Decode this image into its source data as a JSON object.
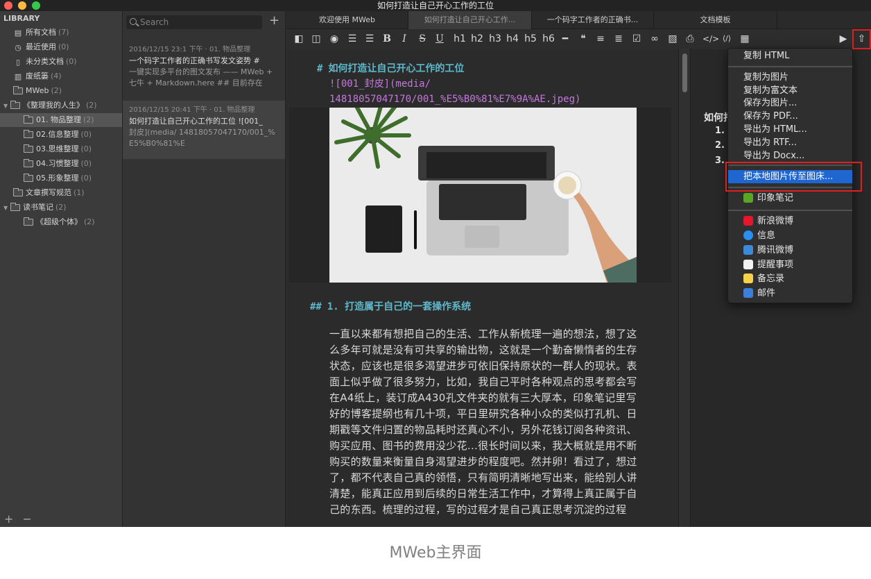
{
  "window": {
    "title": "如何打造让自己开心工作的工位"
  },
  "library": {
    "header": "LIBRARY",
    "items": [
      {
        "label": "所有文档",
        "count": "(7)",
        "icon": "all-docs-icon"
      },
      {
        "label": "最近使用",
        "count": "(0)",
        "icon": "clock-icon"
      },
      {
        "label": "未分类文档",
        "count": "(0)",
        "icon": "unsorted-icon"
      },
      {
        "label": "废纸篓",
        "count": "(4)",
        "icon": "trash-icon"
      },
      {
        "label": "MWeb",
        "count": "(2)",
        "icon": "folder-icon"
      },
      {
        "label": "《整理我的人生》",
        "count": "(2)",
        "icon": "folder-icon"
      },
      {
        "label": "01. 物品整理",
        "count": "(2)",
        "icon": "folder-icon"
      },
      {
        "label": "02.信息整理",
        "count": "(0)",
        "icon": "folder-icon"
      },
      {
        "label": "03.思维整理",
        "count": "(0)",
        "icon": "folder-icon"
      },
      {
        "label": "04.习惯整理",
        "count": "(0)",
        "icon": "folder-icon"
      },
      {
        "label": "05.形象整理",
        "count": "(0)",
        "icon": "folder-icon"
      },
      {
        "label": "文章撰写规范",
        "count": "(1)",
        "icon": "folder-icon"
      },
      {
        "label": "读书笔记",
        "count": "(2)",
        "icon": "folder-icon"
      },
      {
        "label": "《超级个体》",
        "count": "(2)",
        "icon": "folder-icon"
      }
    ],
    "bottom_add": "+",
    "bottom_remove": "−"
  },
  "doclist": {
    "search_placeholder": "Search",
    "add": "+",
    "docs": [
      {
        "meta": "2016/12/15 23:1 下午 · 01. 物品整理",
        "title": "一个码字工作者的正确书写发文姿势 #",
        "preview": "一键实现多平台的图文发布 —— MWeb + 七牛 + Markdown.here ## 目前存在"
      },
      {
        "meta": "2016/12/15 20:41 下午 · 01. 物品整理",
        "title": "如何打造让自己开心工作的工位 ![001_",
        "preview": "封皮](media/ 14818057047170/001_%E5%B0%81%E"
      }
    ]
  },
  "tabs": [
    "欢迎使用 MWeb",
    "如何打造让自己开心工作...",
    "一个码字工作者的正确书...",
    "文档模板"
  ],
  "toolbar": {
    "bold": "B",
    "italic": "I",
    "strike": "S",
    "underline": "U",
    "h1": "h1",
    "h2": "h2",
    "h3": "h3",
    "h4": "h4",
    "h5": "h5",
    "h6": "h6",
    "quote": "❝"
  },
  "editor": {
    "h1_mark": "#",
    "h1_text": "如何打造让自己开心工作的工位",
    "image_md_line1": "![001_封皮](media/",
    "image_md_line2": "14818057047170/001_%E5%B0%81%E7%9A%AE.jpeg)",
    "h2_mark": "##",
    "h2_text": "1. 打造属于自己的一套操作系统",
    "paragraph": "一直以来都有想把自己的生活、工作从新梳理一遍的想法，想了这么多年可就是没有可共享的输出物，这就是一个勤奋懒惰者的生存状态，应该也是很多渴望进步可依旧保持原状的一群人的现状。表面上似乎做了很多努力，比如，我自己平时各种观点的思考都会写在A4纸上，装订成A430孔文件夹的就有三大厚本，印象笔记里写好的博客提纲也有几十项，平日里研究各种小众的类似打孔机、日期戳等文件归置的物品耗时还真心不小，另外花钱订阅各种资讯、购买应用、图书的费用没少花...很长时间以来，我大概就是用不断购买的数量来衡量自身渴望进步的程度吧。然并卵！看过了，想过了，都不代表自己真的领悟，只有简明清晰地写出来，能给别人讲清楚，能真正应用到后续的日常生活工作中，才算得上真正属于自己的东西。梳理的过程，写的过程才是自己真正思考沉淀的过程"
  },
  "preview": {
    "title": "如何打",
    "nums": [
      "1.",
      "2.",
      "3."
    ]
  },
  "share_menu": {
    "items": [
      "复制 HTML",
      "复制为图片",
      "复制为富文本",
      "保存为图片...",
      "保存为 PDF...",
      "导出为 HTML...",
      "导出为 RTF...",
      "导出为 Docx...",
      "把本地图片传至图床...",
      "印象笔记",
      "新浪微博",
      "信息",
      "腾讯微博",
      "提醒事项",
      "备忘录",
      "邮件"
    ],
    "icon_colors": {
      "evernote": "#5ba525",
      "weibo": "#e6162d",
      "messages": "#2b8ff0",
      "tencent_weibo": "#3d8ad8",
      "reminders": "#f2f2f2",
      "notes": "#f7d14a",
      "mail": "#3d7fd8"
    }
  },
  "caption": "MWeb主界面",
  "colors": {
    "highlight": "#1f66d1",
    "annotation_red": "#e02020",
    "heading_cyan": "#5fb8cc",
    "link_purple": "#c678dd"
  }
}
